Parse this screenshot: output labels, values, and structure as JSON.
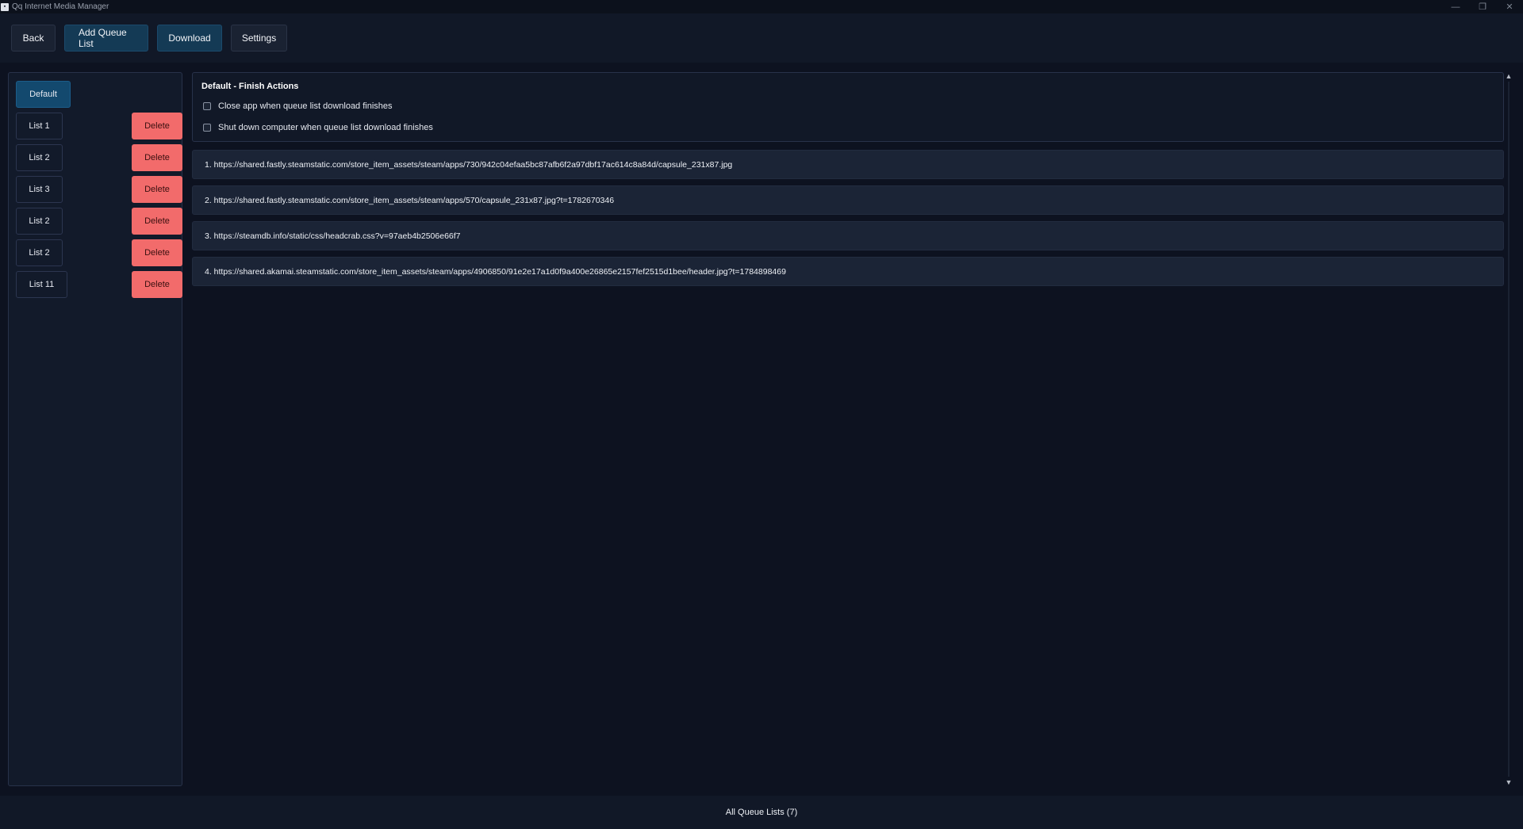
{
  "window": {
    "title": "Qq Internet Media Manager",
    "controls": [
      "minimize-icon",
      "restore-icon",
      "close-icon"
    ]
  },
  "toolbar": {
    "back_label": "Back",
    "add_queue_label": "Add Queue List",
    "download_label": "Download",
    "settings_label": "Settings"
  },
  "sidebar": {
    "items": [
      {
        "label": "Default",
        "active": true,
        "deletable": false
      },
      {
        "label": "List 1",
        "active": false,
        "deletable": true
      },
      {
        "label": "List 2",
        "active": false,
        "deletable": true
      },
      {
        "label": "List 3",
        "active": false,
        "deletable": true
      },
      {
        "label": "List 2",
        "active": false,
        "deletable": true
      },
      {
        "label": "List 2",
        "active": false,
        "deletable": true
      },
      {
        "label": "List 11",
        "active": false,
        "deletable": true
      }
    ],
    "delete_label": "Delete"
  },
  "finish_actions": {
    "title": "Default - Finish Actions",
    "options": [
      {
        "label": "Close app when queue list download finishes",
        "checked": false
      },
      {
        "label": "Shut down computer when queue list download finishes",
        "checked": false
      }
    ]
  },
  "queue_items": [
    "1. https://shared.fastly.steamstatic.com/store_item_assets/steam/apps/730/942c04efaa5bc87afb6f2a97dbf17ac614c8a84d/capsule_231x87.jpg",
    "2. https://shared.fastly.steamstatic.com/store_item_assets/steam/apps/570/capsule_231x87.jpg?t=1782670346",
    "3. https://steamdb.info/static/css/headcrab.css?v=97aeb4b2506e66f7",
    "4. https://shared.akamai.steamstatic.com/store_item_assets/steam/apps/4906850/91e2e17a1d0f9a400e26865e2157fef2515d1bee/header.jpg?t=1784898469"
  ],
  "footer": {
    "label": "All Queue Lists (7)"
  },
  "colors": {
    "background": "#0d1220",
    "panel": "#111827",
    "accent_active": "#13496e",
    "delete": "#f26b6b"
  }
}
